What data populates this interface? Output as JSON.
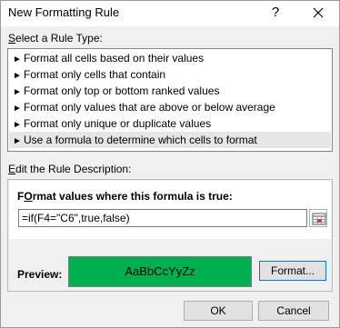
{
  "dialog": {
    "title": "New Formatting Rule",
    "help_glyph": "?"
  },
  "rule_type": {
    "label_underline": "S",
    "label_rest": "elect a Rule Type:",
    "items": [
      {
        "label": "Format all cells based on their values",
        "selected": false
      },
      {
        "label": "Format only cells that contain",
        "selected": false
      },
      {
        "label": "Format only top or bottom ranked values",
        "selected": false
      },
      {
        "label": "Format only values that are above or below average",
        "selected": false
      },
      {
        "label": "Format only unique or duplicate values",
        "selected": false
      },
      {
        "label": "Use a formula to determine which cells to format",
        "selected": true
      }
    ],
    "arrow_glyph": "►"
  },
  "description": {
    "label_underline": "E",
    "label_rest": "dit the Rule Description:",
    "heading_underline": "O",
    "heading_prefix": "F",
    "heading_rest": "rmat values where this formula is true:",
    "formula_value": "=if(F4=\"C6\",true,false)",
    "preview_label": "Preview:",
    "preview_sample": "AaBbCcYyZz",
    "preview_fill": "#00b050",
    "format_button": "Format..."
  },
  "buttons": {
    "ok": "OK",
    "cancel": "Cancel"
  }
}
